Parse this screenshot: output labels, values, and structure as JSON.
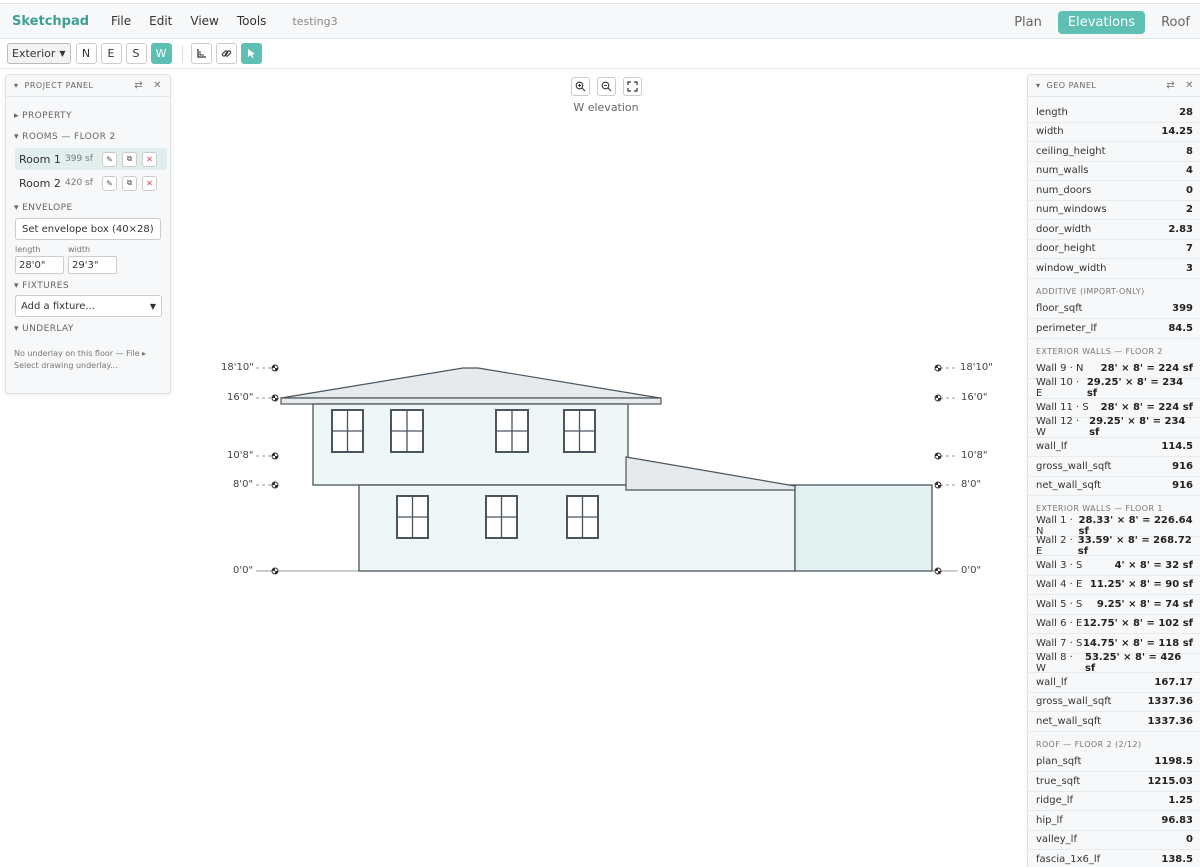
{
  "app": {
    "brand": "Sketchpad",
    "menu": [
      "File",
      "Edit",
      "View",
      "Tools"
    ],
    "doc_name": "testing3"
  },
  "views": [
    "Plan",
    "Elevations",
    "Roof"
  ],
  "active_view": "Elevations",
  "toolbar": {
    "mode": "Exterior",
    "directions": [
      "N",
      "E",
      "S",
      "W"
    ],
    "active_direction": "W"
  },
  "project_panel": {
    "title": "PROJECT PANEL",
    "property_label": "▸ PROPERTY",
    "rooms_label": "▾ ROOMS — FLOOR 2",
    "rooms": [
      {
        "name": "Room 1",
        "sf": "399 sf"
      },
      {
        "name": "Room 2",
        "sf": "420 sf"
      }
    ],
    "envelope_label": "▾ ENVELOPE",
    "envelope_button": "Set envelope box (40×28)",
    "length_label": "length",
    "length_value": "28'0\"",
    "width_label": "width",
    "width_value": "29'3\"",
    "fixtures_label": "▾ FIXTURES",
    "fixture_placeholder": "Add a fixture...",
    "underlay_label": "▾ UNDERLAY",
    "underlay_text": "No underlay on this floor — File ▸ Select drawing underlay..."
  },
  "canvas": {
    "title": "W elevation",
    "levels": [
      "18'10\"",
      "16'0\"",
      "10'8\"",
      "8'0\"",
      "0'0\""
    ]
  },
  "geo_panel": {
    "title": "GEO PANEL",
    "room_rows": [
      {
        "k": "length",
        "v": "28"
      },
      {
        "k": "width",
        "v": "14.25"
      },
      {
        "k": "ceiling_height",
        "v": "8"
      },
      {
        "k": "num_walls",
        "v": "4"
      },
      {
        "k": "num_doors",
        "v": "0"
      },
      {
        "k": "num_windows",
        "v": "2"
      },
      {
        "k": "door_width",
        "v": "2.83"
      },
      {
        "k": "door_height",
        "v": "7"
      },
      {
        "k": "window_width",
        "v": "3"
      }
    ],
    "additive_label": "ADDITIVE (IMPORT-ONLY)",
    "additive_rows": [
      {
        "k": "floor_sqft",
        "v": "399"
      },
      {
        "k": "perimeter_lf",
        "v": "84.5"
      }
    ],
    "ext2_label": "EXTERIOR WALLS — FLOOR 2",
    "ext2_rows": [
      {
        "k": "Wall 9 · N",
        "v": "28' × 8' = 224 sf"
      },
      {
        "k": "Wall 10 · E",
        "v": "29.25' × 8' = 234 sf"
      },
      {
        "k": "Wall 11 · S",
        "v": "28' × 8' = 224 sf"
      },
      {
        "k": "Wall 12 · W",
        "v": "29.25' × 8' = 234 sf"
      },
      {
        "k": "wall_lf",
        "v": "114.5"
      },
      {
        "k": "gross_wall_sqft",
        "v": "916"
      },
      {
        "k": "net_wall_sqft",
        "v": "916"
      }
    ],
    "ext1_label": "EXTERIOR WALLS — FLOOR 1",
    "ext1_rows": [
      {
        "k": "Wall 1 · N",
        "v": "28.33' × 8' = 226.64 sf"
      },
      {
        "k": "Wall 2 · E",
        "v": "33.59' × 8' = 268.72 sf"
      },
      {
        "k": "Wall 3 · S",
        "v": "4' × 8' = 32 sf"
      },
      {
        "k": "Wall 4 · E",
        "v": "11.25' × 8' = 90 sf"
      },
      {
        "k": "Wall 5 · S",
        "v": "9.25' × 8' = 74 sf"
      },
      {
        "k": "Wall 6 · E",
        "v": "12.75' × 8' = 102 sf"
      },
      {
        "k": "Wall 7 · S",
        "v": "14.75' × 8' = 118 sf"
      },
      {
        "k": "Wall 8 · W",
        "v": "53.25' × 8' = 426 sf"
      },
      {
        "k": "wall_lf",
        "v": "167.17"
      },
      {
        "k": "gross_wall_sqft",
        "v": "1337.36"
      },
      {
        "k": "net_wall_sqft",
        "v": "1337.36"
      }
    ],
    "roof_label": "ROOF — FLOOR 2 (2/12)",
    "roof_rows": [
      {
        "k": "plan_sqft",
        "v": "1198.5"
      },
      {
        "k": "true_sqft",
        "v": "1215.03"
      },
      {
        "k": "ridge_lf",
        "v": "1.25"
      },
      {
        "k": "hip_lf",
        "v": "96.83"
      },
      {
        "k": "valley_lf",
        "v": "0"
      },
      {
        "k": "fascia_1x6_lf",
        "v": "138.5"
      }
    ]
  },
  "colors": {
    "accent": "#5ebfb3",
    "brand": "#3f9f93",
    "wall_fill": "#eef7f6",
    "roof_fill": "#e6eaec",
    "outline": "#4a555c"
  }
}
